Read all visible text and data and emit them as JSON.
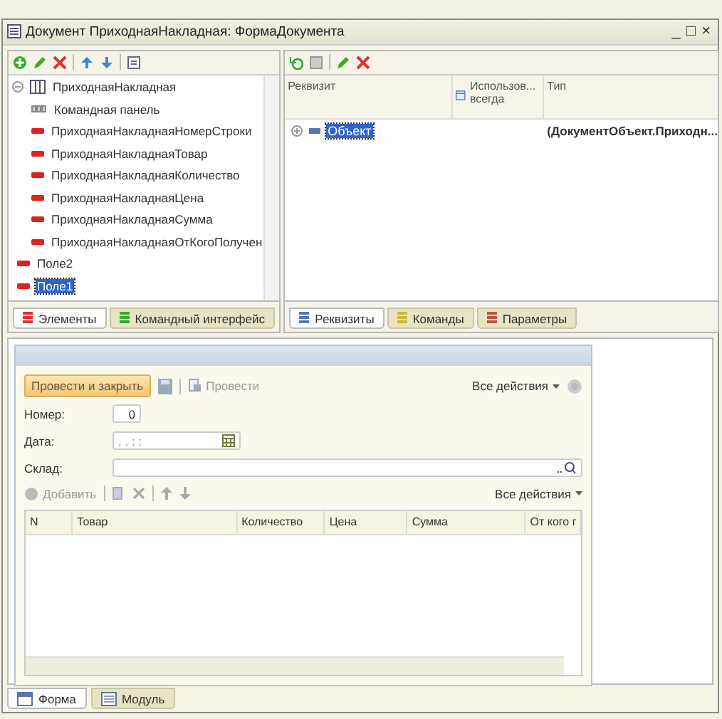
{
  "window": {
    "title": "Документ ПриходнаяНакладная: ФормаДокумента"
  },
  "window_controls": [
    "_",
    "□",
    "×"
  ],
  "tree": [
    {
      "label": "ПриходнаяНакладная",
      "kind": "table",
      "expanded": true,
      "selected": false,
      "children": [
        {
          "label": "Командная панель",
          "kind": "panel",
          "selected": false
        },
        {
          "label": "ПриходнаяНакладнаяНомерСтроки",
          "kind": "field",
          "selected": false
        },
        {
          "label": "ПриходнаяНакладнаяТовар",
          "kind": "field",
          "selected": false
        },
        {
          "label": "ПриходнаяНакладнаяКоличество",
          "kind": "field",
          "selected": false
        },
        {
          "label": "ПриходнаяНакладнаяЦена",
          "kind": "field",
          "selected": false
        },
        {
          "label": "ПриходнаяНакладнаяСумма",
          "kind": "field",
          "selected": false
        },
        {
          "label": "ПриходнаяНакладнаяОтКогоПолучен",
          "kind": "field",
          "selected": false
        }
      ]
    },
    {
      "label": "Поле2",
      "kind": "field",
      "selected": false
    },
    {
      "label": "Поле1",
      "kind": "field",
      "selected": true
    }
  ],
  "left_tabs": [
    {
      "label": "Элементы",
      "selected": true
    },
    {
      "label": "Командный интерфейс",
      "selected": false
    }
  ],
  "attributes": {
    "columns": [
      "Реквизит",
      "Использов... всегда",
      "Тип"
    ],
    "rows": [
      {
        "name": "Объект",
        "type": "(ДокументОбъект.Приходн...",
        "selected": true
      }
    ]
  },
  "right_tabs": [
    {
      "label": "Реквизиты",
      "selected": true
    },
    {
      "label": "Команды",
      "selected": false
    },
    {
      "label": "Параметры",
      "selected": false
    }
  ],
  "form": {
    "post_close": "Провести и закрыть",
    "post": "Провести",
    "all_actions": "Все действия",
    "fields": [
      {
        "label": "Номер:",
        "value": "0",
        "kind": "number"
      },
      {
        "label": "Дата:",
        "value": ". .   : :",
        "kind": "date"
      },
      {
        "label": "Склад:",
        "kind": "select"
      }
    ],
    "table_toolbar": {
      "add": "Добавить",
      "all_actions": "Все действия"
    },
    "columns": [
      "N",
      "Товар",
      "Количество",
      "Цена",
      "Сумма",
      "От кого г"
    ]
  },
  "bottom_tabs": [
    {
      "label": "Форма",
      "selected": true
    },
    {
      "label": "Модуль",
      "selected": false
    }
  ]
}
